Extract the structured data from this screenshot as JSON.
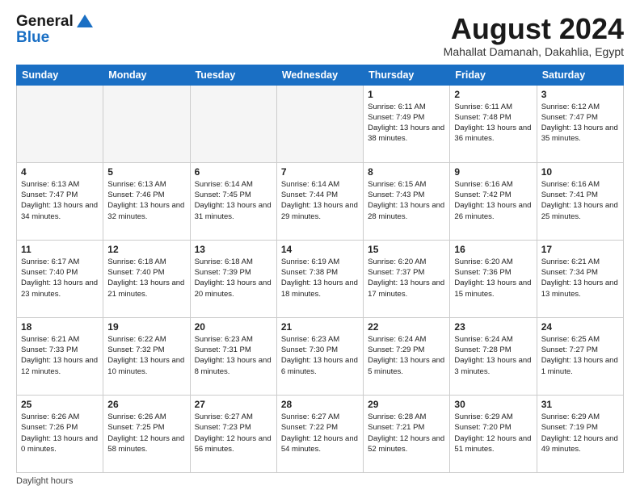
{
  "header": {
    "logo_general": "General",
    "logo_blue": "Blue",
    "month_year": "August 2024",
    "location": "Mahallat Damanah, Dakahlia, Egypt"
  },
  "days_of_week": [
    "Sunday",
    "Monday",
    "Tuesday",
    "Wednesday",
    "Thursday",
    "Friday",
    "Saturday"
  ],
  "weeks": [
    [
      {
        "day": "",
        "info": ""
      },
      {
        "day": "",
        "info": ""
      },
      {
        "day": "",
        "info": ""
      },
      {
        "day": "",
        "info": ""
      },
      {
        "day": "1",
        "info": "Sunrise: 6:11 AM\nSunset: 7:49 PM\nDaylight: 13 hours and 38 minutes."
      },
      {
        "day": "2",
        "info": "Sunrise: 6:11 AM\nSunset: 7:48 PM\nDaylight: 13 hours and 36 minutes."
      },
      {
        "day": "3",
        "info": "Sunrise: 6:12 AM\nSunset: 7:47 PM\nDaylight: 13 hours and 35 minutes."
      }
    ],
    [
      {
        "day": "4",
        "info": "Sunrise: 6:13 AM\nSunset: 7:47 PM\nDaylight: 13 hours and 34 minutes."
      },
      {
        "day": "5",
        "info": "Sunrise: 6:13 AM\nSunset: 7:46 PM\nDaylight: 13 hours and 32 minutes."
      },
      {
        "day": "6",
        "info": "Sunrise: 6:14 AM\nSunset: 7:45 PM\nDaylight: 13 hours and 31 minutes."
      },
      {
        "day": "7",
        "info": "Sunrise: 6:14 AM\nSunset: 7:44 PM\nDaylight: 13 hours and 29 minutes."
      },
      {
        "day": "8",
        "info": "Sunrise: 6:15 AM\nSunset: 7:43 PM\nDaylight: 13 hours and 28 minutes."
      },
      {
        "day": "9",
        "info": "Sunrise: 6:16 AM\nSunset: 7:42 PM\nDaylight: 13 hours and 26 minutes."
      },
      {
        "day": "10",
        "info": "Sunrise: 6:16 AM\nSunset: 7:41 PM\nDaylight: 13 hours and 25 minutes."
      }
    ],
    [
      {
        "day": "11",
        "info": "Sunrise: 6:17 AM\nSunset: 7:40 PM\nDaylight: 13 hours and 23 minutes."
      },
      {
        "day": "12",
        "info": "Sunrise: 6:18 AM\nSunset: 7:40 PM\nDaylight: 13 hours and 21 minutes."
      },
      {
        "day": "13",
        "info": "Sunrise: 6:18 AM\nSunset: 7:39 PM\nDaylight: 13 hours and 20 minutes."
      },
      {
        "day": "14",
        "info": "Sunrise: 6:19 AM\nSunset: 7:38 PM\nDaylight: 13 hours and 18 minutes."
      },
      {
        "day": "15",
        "info": "Sunrise: 6:20 AM\nSunset: 7:37 PM\nDaylight: 13 hours and 17 minutes."
      },
      {
        "day": "16",
        "info": "Sunrise: 6:20 AM\nSunset: 7:36 PM\nDaylight: 13 hours and 15 minutes."
      },
      {
        "day": "17",
        "info": "Sunrise: 6:21 AM\nSunset: 7:34 PM\nDaylight: 13 hours and 13 minutes."
      }
    ],
    [
      {
        "day": "18",
        "info": "Sunrise: 6:21 AM\nSunset: 7:33 PM\nDaylight: 13 hours and 12 minutes."
      },
      {
        "day": "19",
        "info": "Sunrise: 6:22 AM\nSunset: 7:32 PM\nDaylight: 13 hours and 10 minutes."
      },
      {
        "day": "20",
        "info": "Sunrise: 6:23 AM\nSunset: 7:31 PM\nDaylight: 13 hours and 8 minutes."
      },
      {
        "day": "21",
        "info": "Sunrise: 6:23 AM\nSunset: 7:30 PM\nDaylight: 13 hours and 6 minutes."
      },
      {
        "day": "22",
        "info": "Sunrise: 6:24 AM\nSunset: 7:29 PM\nDaylight: 13 hours and 5 minutes."
      },
      {
        "day": "23",
        "info": "Sunrise: 6:24 AM\nSunset: 7:28 PM\nDaylight: 13 hours and 3 minutes."
      },
      {
        "day": "24",
        "info": "Sunrise: 6:25 AM\nSunset: 7:27 PM\nDaylight: 13 hours and 1 minute."
      }
    ],
    [
      {
        "day": "25",
        "info": "Sunrise: 6:26 AM\nSunset: 7:26 PM\nDaylight: 13 hours and 0 minutes."
      },
      {
        "day": "26",
        "info": "Sunrise: 6:26 AM\nSunset: 7:25 PM\nDaylight: 12 hours and 58 minutes."
      },
      {
        "day": "27",
        "info": "Sunrise: 6:27 AM\nSunset: 7:23 PM\nDaylight: 12 hours and 56 minutes."
      },
      {
        "day": "28",
        "info": "Sunrise: 6:27 AM\nSunset: 7:22 PM\nDaylight: 12 hours and 54 minutes."
      },
      {
        "day": "29",
        "info": "Sunrise: 6:28 AM\nSunset: 7:21 PM\nDaylight: 12 hours and 52 minutes."
      },
      {
        "day": "30",
        "info": "Sunrise: 6:29 AM\nSunset: 7:20 PM\nDaylight: 12 hours and 51 minutes."
      },
      {
        "day": "31",
        "info": "Sunrise: 6:29 AM\nSunset: 7:19 PM\nDaylight: 12 hours and 49 minutes."
      }
    ]
  ],
  "footer": {
    "note": "Daylight hours"
  }
}
